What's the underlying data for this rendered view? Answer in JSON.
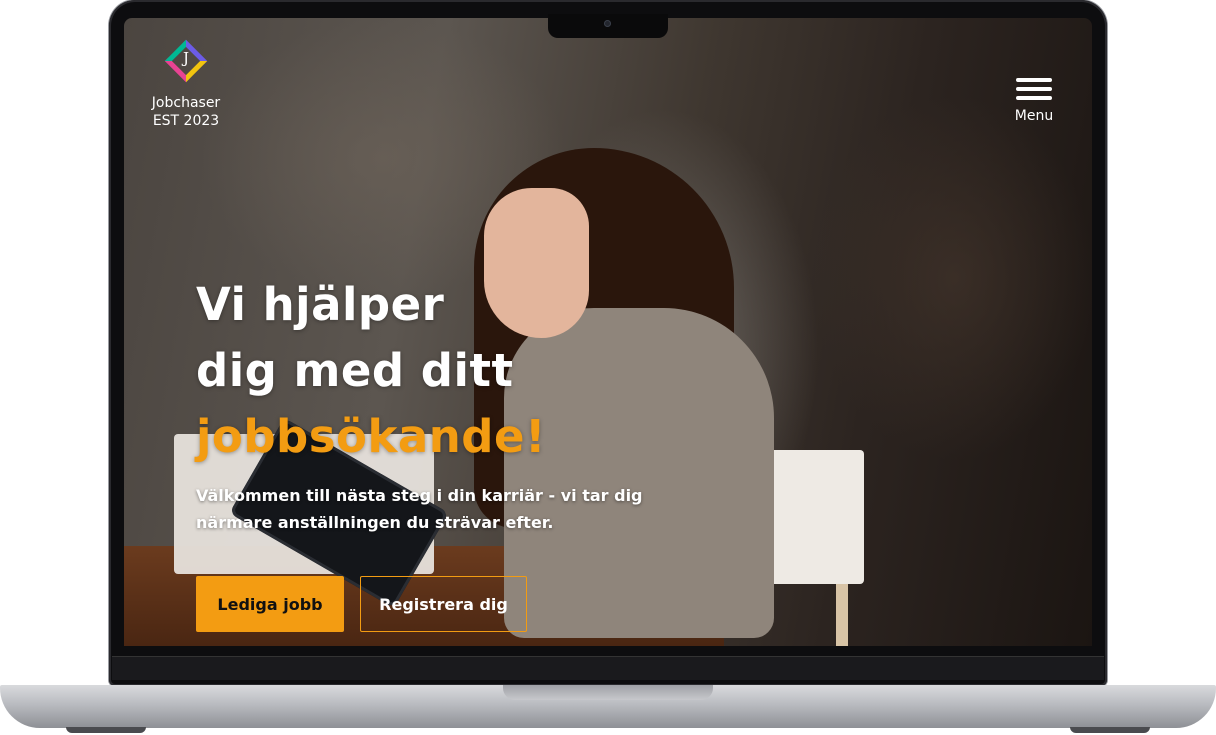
{
  "brand": {
    "logo_letter": "J",
    "name": "Jobchaser",
    "established": "EST 2023",
    "accent_color": "#f39c12"
  },
  "nav": {
    "menu_label": "Menu",
    "menu_icon": "hamburger-icon"
  },
  "hero": {
    "headline_line1": "Vi hjälper",
    "headline_line2": "dig med ditt",
    "headline_accent": "jobbsökande!",
    "subtitle": "Välkommen till nästa steg i din karriär - vi tar dig närmare anställningen du strävar efter.",
    "primary_button": "Lediga jobb",
    "secondary_button": "Registrera dig"
  }
}
